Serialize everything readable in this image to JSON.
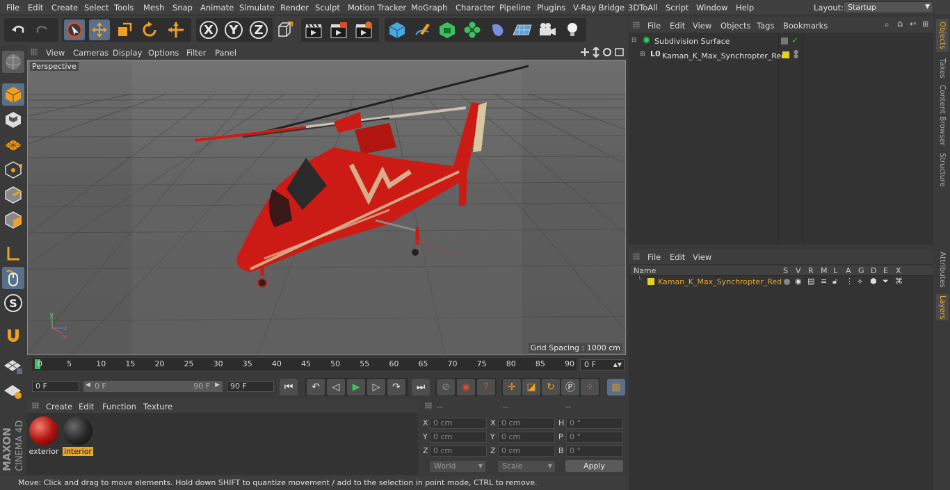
{
  "menubar": {
    "items": [
      "File",
      "Edit",
      "Create",
      "Select",
      "Tools",
      "Mesh",
      "Snap",
      "Animate",
      "Simulate",
      "Render",
      "Sculpt",
      "Motion Tracker",
      "MoGraph",
      "Character",
      "Pipeline",
      "Plugins",
      "V-Ray Bridge",
      "3DToAll",
      "Script",
      "Window",
      "Help"
    ],
    "layout_label": "Layout:",
    "layout_value": "Startup"
  },
  "toolbar": {
    "axis_x": "X",
    "axis_y": "Y",
    "axis_z": "Z"
  },
  "viewport": {
    "menu": [
      "View",
      "Cameras",
      "Display",
      "Options",
      "Filter",
      "Panel"
    ],
    "label": "Perspective",
    "grid_spacing": "Grid Spacing : 1000 cm"
  },
  "timeline": {
    "ticks": [
      "0",
      "5",
      "10",
      "15",
      "20",
      "25",
      "30",
      "35",
      "40",
      "45",
      "50",
      "55",
      "60",
      "65",
      "70",
      "75",
      "80",
      "85",
      "90"
    ],
    "current_frame": "0 F"
  },
  "transport": {
    "start_field": "0 F",
    "range_start": "0 F",
    "range_end": "90 F",
    "end_field": "90 F"
  },
  "material_manager": {
    "menu": [
      "Create",
      "Edit",
      "Function",
      "Texture"
    ],
    "materials": [
      {
        "name": "exterior",
        "selected": false
      },
      {
        "name": "interior",
        "selected": true
      }
    ]
  },
  "coordinates": {
    "header": [
      "--",
      "--",
      "--"
    ],
    "rows": [
      {
        "l1": "X",
        "v1": "0 cm",
        "l2": "X",
        "v2": "0 cm",
        "l3": "H",
        "v3": "0 °"
      },
      {
        "l1": "Y",
        "v1": "0 cm",
        "l2": "Y",
        "v2": "0 cm",
        "l3": "P",
        "v3": "0 °"
      },
      {
        "l1": "Z",
        "v1": "0 cm",
        "l2": "Z",
        "v2": "0 cm",
        "l3": "B",
        "v3": "0 °"
      }
    ],
    "mode1": "World",
    "mode2": "Scale",
    "apply": "Apply"
  },
  "object_manager": {
    "menu": [
      "File",
      "Edit",
      "View",
      "Objects",
      "Tags",
      "Bookmarks"
    ],
    "objects": [
      {
        "name": "Subdivision Surface"
      },
      {
        "name": "Kaman_K_Max_Synchropter_Red"
      }
    ]
  },
  "layer_manager": {
    "menu": [
      "File",
      "Edit",
      "View"
    ],
    "columns": [
      "Name",
      "S",
      "V",
      "R",
      "M",
      "L",
      "A",
      "G",
      "D",
      "E",
      "X"
    ],
    "layers": [
      {
        "name": "Kaman_K_Max_Synchropter_Red",
        "color": "#e6d21e"
      }
    ]
  },
  "side_tabs": [
    "Objects",
    "Takes",
    "Content Browser",
    "Structure",
    "Attributes",
    "Layers"
  ],
  "status": "Move: Click and drag to move elements. Hold down SHIFT to quantize movement / add to the selection in point mode, CTRL to remove.",
  "logo": {
    "line1": "MAXON",
    "line2": "CINEMA 4D"
  },
  "colors": {
    "accent_orange": "#e8a830",
    "select_blue": "#5a6f88",
    "helicopter_red": "#cc1b14"
  }
}
